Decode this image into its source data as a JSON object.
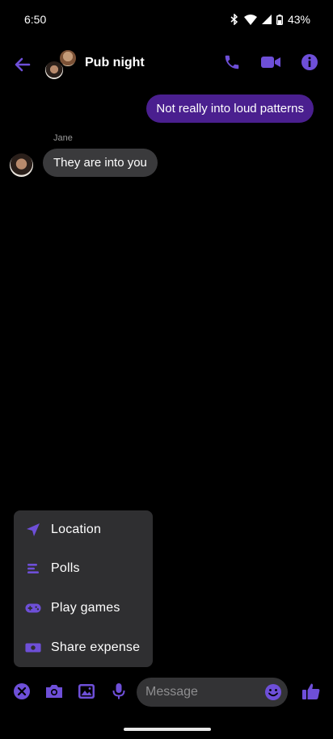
{
  "status_bar": {
    "time": "6:50",
    "battery": "43%"
  },
  "header": {
    "title": "Pub night",
    "icons": [
      "back-arrow",
      "phone",
      "video-camera",
      "info"
    ]
  },
  "messages": [
    {
      "direction": "outgoing",
      "text": "Not really into loud patterns"
    },
    {
      "direction": "incoming",
      "sender": "Jane",
      "text": "They are into you"
    }
  ],
  "popup_menu": {
    "items": [
      {
        "icon": "location-arrow",
        "label": "Location"
      },
      {
        "icon": "polls-bars",
        "label": "Polls"
      },
      {
        "icon": "gamepad",
        "label": "Play games"
      },
      {
        "icon": "money-bill",
        "label": "Share expense"
      }
    ]
  },
  "composer": {
    "placeholder": "Message",
    "icons": [
      "close-circle",
      "camera",
      "image",
      "microphone",
      "emoji",
      "thumbs-up"
    ]
  },
  "colors": {
    "accent": "#6e4fd8",
    "outgoing_bubble": "#4a1f8f",
    "incoming_bubble": "#3a3a3c",
    "menu_bg": "#2f2f31"
  }
}
